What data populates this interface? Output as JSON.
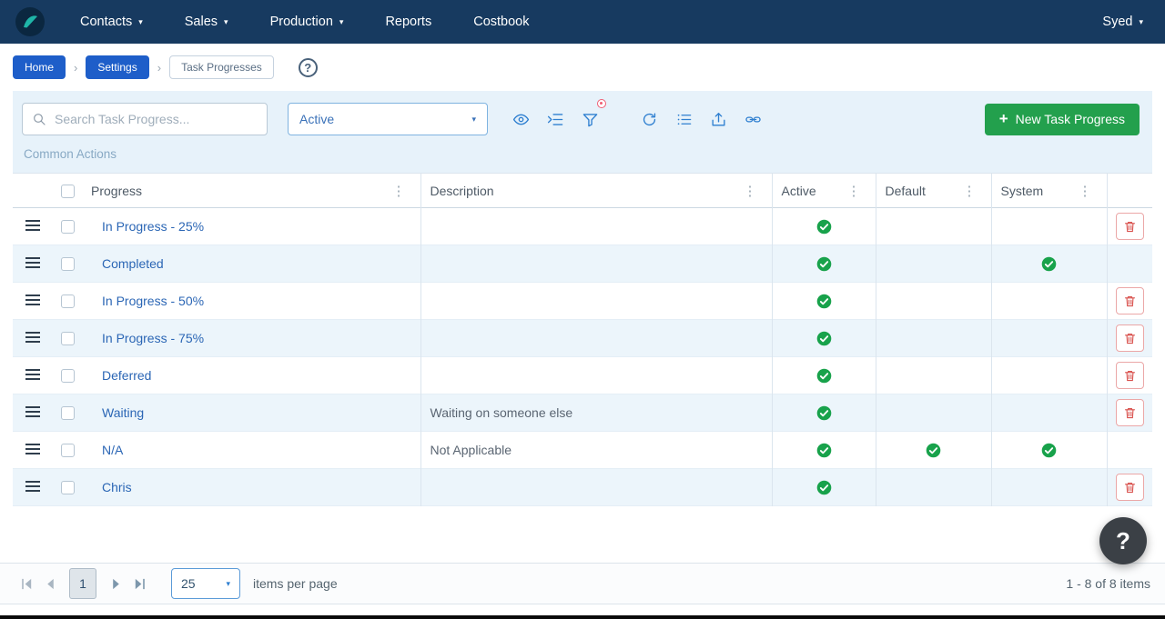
{
  "navbar": {
    "items": [
      {
        "label": "Contacts",
        "has_dropdown": true
      },
      {
        "label": "Sales",
        "has_dropdown": true
      },
      {
        "label": "Production",
        "has_dropdown": true
      },
      {
        "label": "Reports",
        "has_dropdown": false
      },
      {
        "label": "Costbook",
        "has_dropdown": false
      }
    ],
    "user_label": "Syed"
  },
  "breadcrumb": {
    "items": [
      {
        "label": "Home"
      },
      {
        "label": "Settings"
      },
      {
        "label": "Task Progresses"
      }
    ]
  },
  "toolbar": {
    "search_placeholder": "Search Task Progress...",
    "status_filter_value": "Active",
    "new_button_label": "New Task Progress",
    "new_button_plus": "+",
    "common_actions_label": "Common Actions",
    "icon_buttons": [
      "view-icon",
      "indent-icon",
      "filter-icon",
      "refresh-icon",
      "list-icon",
      "export-icon",
      "link-icon"
    ]
  },
  "table": {
    "columns": [
      "Progress",
      "Description",
      "Active",
      "Default",
      "System"
    ],
    "rows": [
      {
        "progress": "In Progress - 25%",
        "description": "",
        "active": true,
        "default": false,
        "system": false,
        "deletable": true
      },
      {
        "progress": "Completed",
        "description": "",
        "active": true,
        "default": false,
        "system": true,
        "deletable": false
      },
      {
        "progress": "In Progress - 50%",
        "description": "",
        "active": true,
        "default": false,
        "system": false,
        "deletable": true
      },
      {
        "progress": "In Progress - 75%",
        "description": "",
        "active": true,
        "default": false,
        "system": false,
        "deletable": true
      },
      {
        "progress": "Deferred",
        "description": "",
        "active": true,
        "default": false,
        "system": false,
        "deletable": true
      },
      {
        "progress": "Waiting",
        "description": "Waiting on someone else",
        "active": true,
        "default": false,
        "system": false,
        "deletable": true
      },
      {
        "progress": "N/A",
        "description": "Not Applicable",
        "active": true,
        "default": true,
        "system": true,
        "deletable": false
      },
      {
        "progress": "Chris",
        "description": "",
        "active": true,
        "default": false,
        "system": false,
        "deletable": true
      }
    ]
  },
  "pager": {
    "current_page": "1",
    "page_size": "25",
    "items_per_page_label": "items per page",
    "range_label": "1 - 8 of 8 items"
  },
  "floating_help_label": "?",
  "colors": {
    "navbar_bg": "#173A60",
    "accent_blue": "#1E5EC9",
    "accent_green": "#23A04D",
    "link_blue": "#2B66B5",
    "check_green": "#18A24B",
    "danger_red": "#D9534F",
    "panel_bg": "#E7F2FA"
  }
}
